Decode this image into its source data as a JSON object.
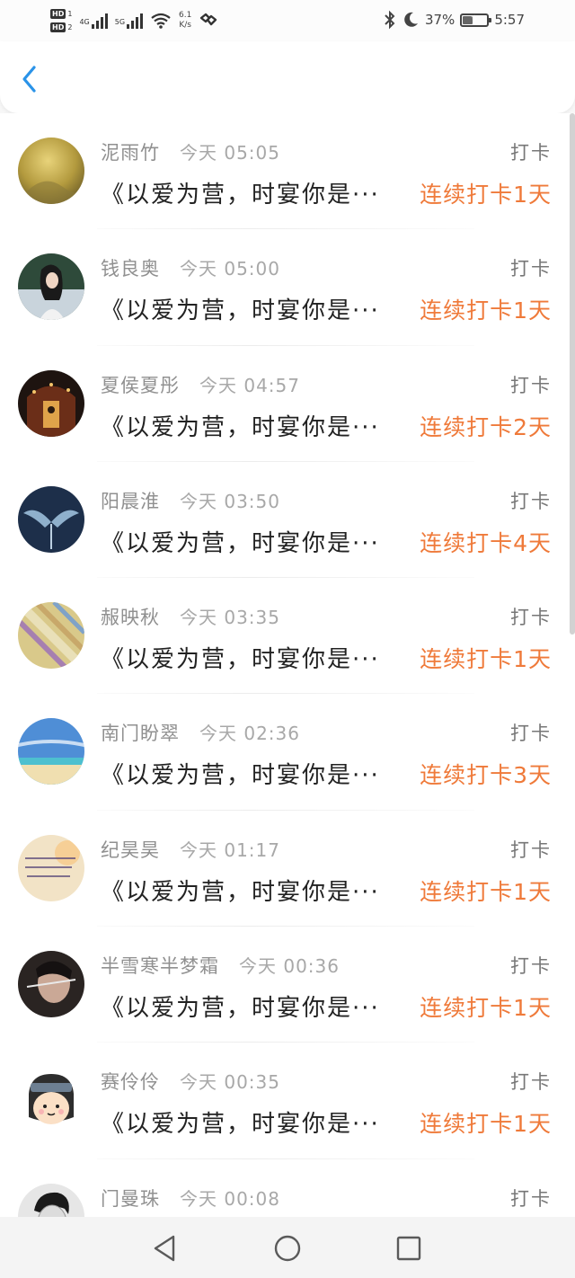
{
  "status_bar": {
    "hd1": "HD",
    "hd1_num": "1",
    "hd2": "HD",
    "hd2_num": "2",
    "sig1_label": "4G",
    "sig2_label": "5G",
    "speed_value": "6.1",
    "speed_unit": "K/s",
    "battery": "37%",
    "battery_level": 0.37,
    "time": "5:57"
  },
  "list": {
    "tag_label": "打卡",
    "book_title": "《以爱为营，时宴你是···",
    "items": [
      {
        "name": "泥雨竹",
        "time": "今天 05:05",
        "streak": "连续打卡1天"
      },
      {
        "name": "钱良奥",
        "time": "今天 05:00",
        "streak": "连续打卡1天"
      },
      {
        "name": "夏侯夏彤",
        "time": "今天 04:57",
        "streak": "连续打卡2天"
      },
      {
        "name": "阳晨淮",
        "time": "今天 03:50",
        "streak": "连续打卡4天"
      },
      {
        "name": "赧映秋",
        "time": "今天 03:35",
        "streak": "连续打卡1天"
      },
      {
        "name": "南门盼翠",
        "time": "今天 02:36",
        "streak": "连续打卡3天"
      },
      {
        "name": "纪昊昊",
        "time": "今天 01:17",
        "streak": "连续打卡1天"
      },
      {
        "name": "半雪寒半梦霜",
        "time": "今天 00:36",
        "streak": "连续打卡1天"
      },
      {
        "name": "赛伶伶",
        "time": "今天 00:35",
        "streak": "连续打卡1天"
      },
      {
        "name": "门曼珠",
        "time": "今天 00:08",
        "streak": ""
      }
    ]
  },
  "colors": {
    "streak": "#ef7a3a",
    "back_arrow": "#2a93e8",
    "name": "#909090",
    "book": "#222222"
  },
  "icons": [
    "back-arrow-icon",
    "bluetooth-icon",
    "moon-icon",
    "battery-icon",
    "nav-back-icon",
    "nav-home-icon",
    "nav-recents-icon"
  ]
}
